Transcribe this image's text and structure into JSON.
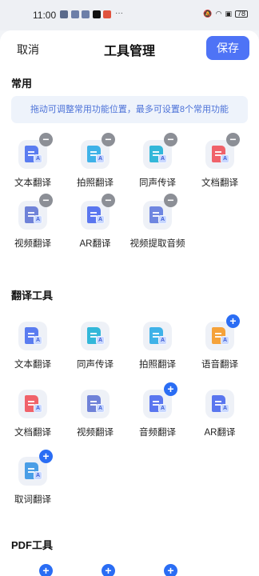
{
  "status_bar": {
    "time": "11:00",
    "battery": "78"
  },
  "header": {
    "cancel_label": "取消",
    "title": "工具管理",
    "save_label": "保存"
  },
  "common": {
    "title": "常用",
    "hint": "拖动可调整常用功能位置，最多可设置8个常用功能",
    "items": [
      {
        "label": "文本翻译",
        "icon": "text-translate-icon",
        "color": "#5a7cf0"
      },
      {
        "label": "拍照翻译",
        "icon": "photo-translate-icon",
        "color": "#3fb2e8"
      },
      {
        "label": "同声传译",
        "icon": "simultaneous-interpret-icon",
        "color": "#33b7d9"
      },
      {
        "label": "文档翻译",
        "icon": "document-translate-icon",
        "color": "#f0626a"
      },
      {
        "label": "视频翻译",
        "icon": "video-translate-icon",
        "color": "#6f82d8"
      },
      {
        "label": "AR翻译",
        "icon": "ar-translate-icon",
        "color": "#5a76ef"
      },
      {
        "label": "视频提取音频",
        "icon": "video-extract-audio-icon",
        "color": "#6f86e0"
      }
    ]
  },
  "translate_tools": {
    "title": "翻译工具",
    "items": [
      {
        "label": "文本翻译",
        "icon": "text-translate-icon",
        "color": "#5a7cf0",
        "badge": ""
      },
      {
        "label": "同声传译",
        "icon": "simultaneous-interpret-icon",
        "color": "#33b7d9",
        "badge": ""
      },
      {
        "label": "拍照翻译",
        "icon": "photo-translate-icon",
        "color": "#3fb2e8",
        "badge": ""
      },
      {
        "label": "语音翻译",
        "icon": "voice-translate-icon",
        "color": "#f5a23a",
        "badge": "+"
      },
      {
        "label": "文档翻译",
        "icon": "document-translate-icon",
        "color": "#f0626a",
        "badge": ""
      },
      {
        "label": "视频翻译",
        "icon": "video-translate-icon",
        "color": "#6f82d8",
        "badge": ""
      },
      {
        "label": "音频翻译",
        "icon": "audio-translate-icon",
        "color": "#5a76ef",
        "badge": "+"
      },
      {
        "label": "AR翻译",
        "icon": "ar-translate-icon",
        "color": "#5a76ef",
        "badge": ""
      },
      {
        "label": "取词翻译",
        "icon": "word-pick-translate-icon",
        "color": "#4a9ee6",
        "badge": "+"
      }
    ]
  },
  "pdf_tools": {
    "title": "PDF工具"
  }
}
